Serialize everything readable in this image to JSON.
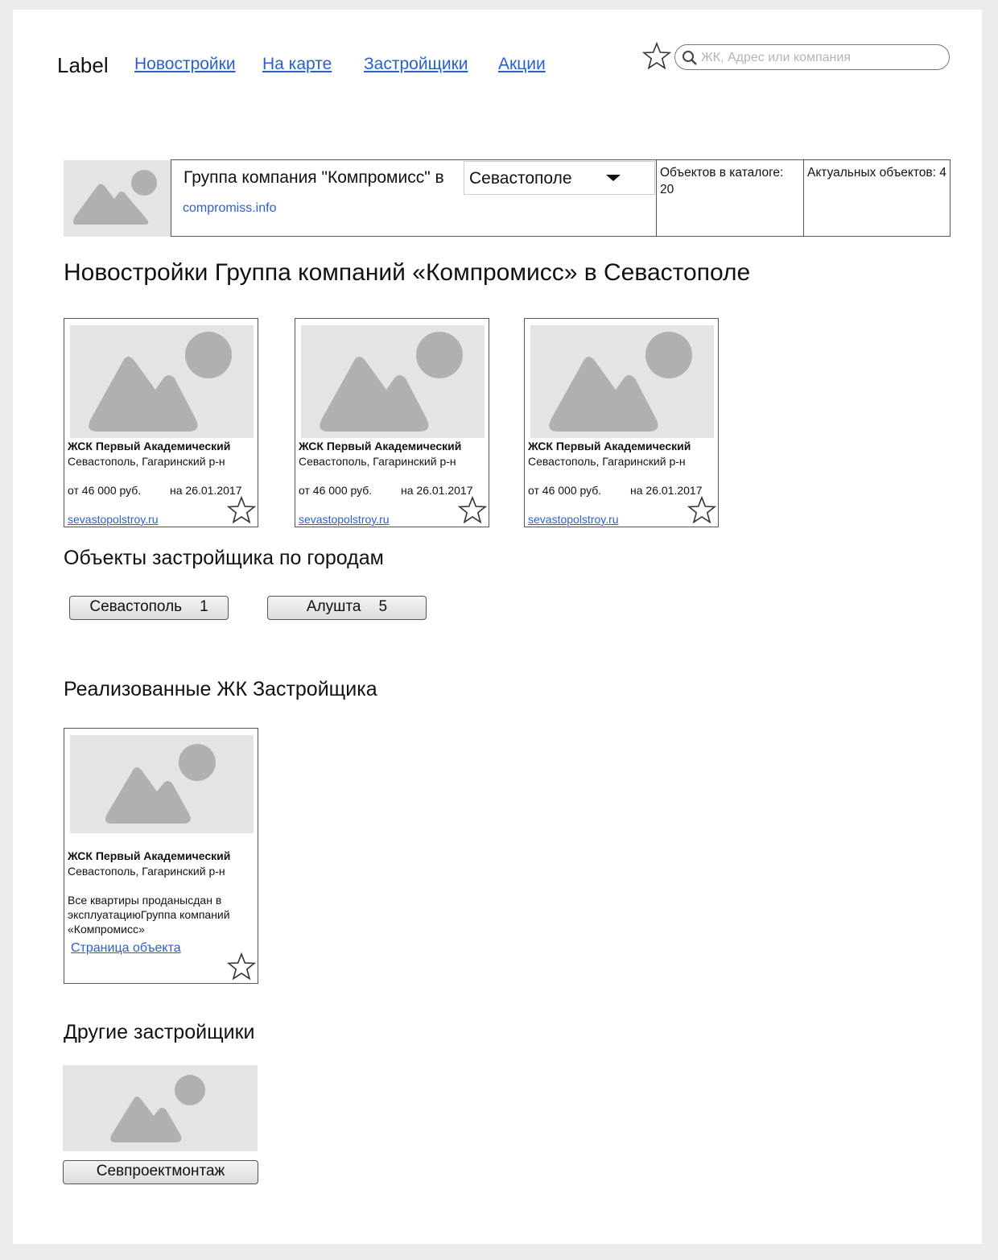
{
  "header": {
    "logo": "Label",
    "nav": [
      "Новостройки",
      "На карте",
      "Застройщики",
      "Акции"
    ],
    "search_placeholder": "ЖК, Адрес или компания"
  },
  "company": {
    "name": "Группа компания \"Компромисс\" в",
    "site": "compromiss.info",
    "city": "Севастополе",
    "stat_catalog": "Объектов в каталоге: 20",
    "stat_active": "Актуальных объектов: 4"
  },
  "sections": {
    "new_title": "Новостройки Группа компаний «Компромисс» в Севастополе",
    "cities_title": "Объекты застройщика по городам",
    "done_title": "Реализованные ЖК Застройщика",
    "other_title": "Другие застройщики"
  },
  "new_cards": [
    {
      "name": "ЖСК Первый Академический",
      "location": "Севастополь, Гагаринский р-н",
      "price": "от 46 000 руб.",
      "date": "на 26.01.2017",
      "site": "sevastopolstroy.ru"
    },
    {
      "name": "ЖСК Первый Академический",
      "location": "Севастополь, Гагаринский р-н",
      "price": "от 46 000 руб.",
      "date": "на 26.01.2017",
      "site": "sevastopolstroy.ru"
    },
    {
      "name": "ЖСК Первый Академический",
      "location": "Севастополь, Гагаринский р-н",
      "price": "от 46 000 руб.",
      "date": "на 26.01.2017",
      "site": "sevastopolstroy.ru"
    }
  ],
  "cities": [
    {
      "name": "Севастополь",
      "count": "1"
    },
    {
      "name": "Алушта",
      "count": "5"
    }
  ],
  "done_card": {
    "name": "ЖСК Первый Академический",
    "location": "Севастополь, Гагаринский р-н",
    "description": "Все квартиры проданысдан в эксплуатациюГруппа компаний «Компромисс»",
    "link": "Страница объекта"
  },
  "other_developers": [
    {
      "name": "Севпроектмонтаж"
    }
  ],
  "icons": {
    "favorite": "star-outline-icon",
    "search": "magnifier-icon",
    "placeholder": "image-placeholder-icon",
    "dropdown": "caret-down-icon"
  },
  "colors": {
    "link": "#2a5fd0",
    "placeholder_bg": "#e4e4e4",
    "placeholder_shape": "#b0b0b0"
  }
}
